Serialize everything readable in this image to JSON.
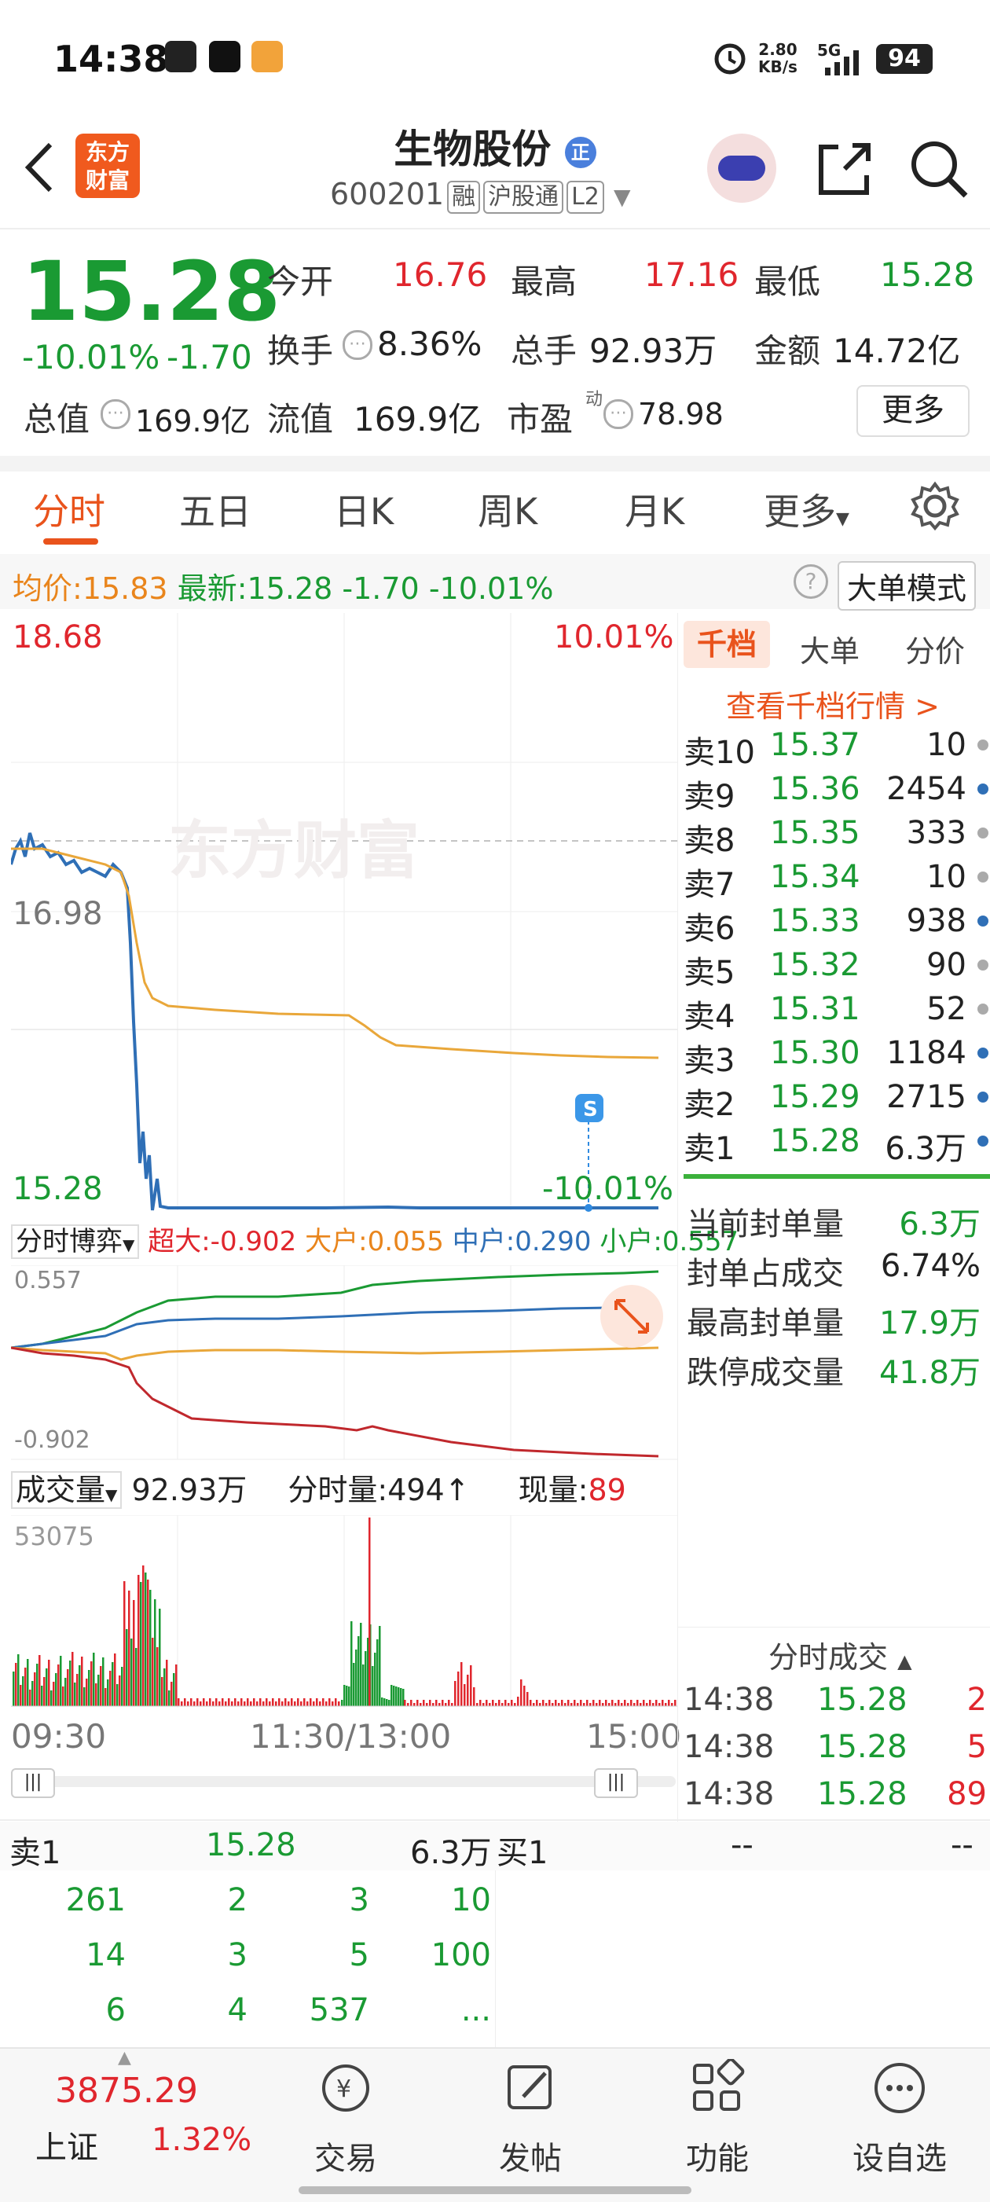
{
  "status_bar": {
    "time": "14:38",
    "net_speed": "2.80",
    "net_unit": "KB/s",
    "signal": "5G",
    "battery": "94"
  },
  "header": {
    "logo_line1": "东方",
    "logo_line2": "财富",
    "title": "生物股份",
    "title_badge": "正",
    "code": "600201",
    "tag1": "融",
    "tag2": "沪股通",
    "tag3": "L2"
  },
  "quote": {
    "price": "15.28",
    "change_pct": "-10.01%",
    "change": "-1.70",
    "open_label": "今开",
    "open": "16.76",
    "high_label": "最高",
    "high": "17.16",
    "low_label": "最低",
    "low": "15.28",
    "turnover_label": "换手",
    "turnover": "8.36%",
    "volume_label": "总手",
    "volume": "92.93万",
    "amount_label": "金额",
    "amount": "14.72亿",
    "mktcap_label": "总值",
    "mktcap": "169.9亿",
    "float_label": "流值",
    "float": "169.9亿",
    "pe_label": "市盈",
    "pe_sup": "动",
    "pe": "78.98",
    "more": "更多"
  },
  "tabs": [
    "分时",
    "五日",
    "日K",
    "周K",
    "月K",
    "更多"
  ],
  "info_line": {
    "avg_label": "均价:",
    "avg": "15.83",
    "latest_label": "最新:",
    "latest": "15.28",
    "chg": "-1.70",
    "pct": "-10.01%",
    "mode_btn": "大单模式"
  },
  "chart": {
    "top_price": "18.68",
    "top_pct": "10.01%",
    "prev_close": "16.98",
    "bottom_price": "15.28",
    "bottom_pct": "-10.01%",
    "marker": "S"
  },
  "flow": {
    "select": "分时博弈",
    "super_label": "超大:",
    "super": "-0.902",
    "big_label": "大户:",
    "big": "0.055",
    "mid_label": "中户:",
    "mid": "0.290",
    "small_label": "小户:",
    "small": "0.557",
    "top": "0.557",
    "bottom": "-0.902"
  },
  "vol": {
    "select": "成交量",
    "total": "92.93万",
    "period_label": "分时量:",
    "period": "494",
    "now_label": "现量:",
    "now": "89",
    "max": "53075"
  },
  "time_axis": [
    "09:30",
    "11:30/13:00",
    "15:00"
  ],
  "order_tabs": [
    "千档",
    "大单",
    "分价"
  ],
  "order_link": "查看千档行情 >",
  "asks": [
    {
      "label": "卖10",
      "price": "15.37",
      "vol": "10",
      "dot": "gray"
    },
    {
      "label": "卖9",
      "price": "15.36",
      "vol": "2454",
      "dot": "blue"
    },
    {
      "label": "卖8",
      "price": "15.35",
      "vol": "333",
      "dot": "gray"
    },
    {
      "label": "卖7",
      "price": "15.34",
      "vol": "10",
      "dot": "gray"
    },
    {
      "label": "卖6",
      "price": "15.33",
      "vol": "938",
      "dot": "blue"
    },
    {
      "label": "卖5",
      "price": "15.32",
      "vol": "90",
      "dot": "gray"
    },
    {
      "label": "卖4",
      "price": "15.31",
      "vol": "52",
      "dot": "gray"
    },
    {
      "label": "卖3",
      "price": "15.30",
      "vol": "1184",
      "dot": "blue"
    },
    {
      "label": "卖2",
      "price": "15.29",
      "vol": "2715",
      "dot": "blue"
    },
    {
      "label": "卖1",
      "price": "15.28",
      "vol": "6.3万",
      "dot": "blue"
    }
  ],
  "seal_stats": [
    {
      "label": "当前封单量",
      "value": "6.3万"
    },
    {
      "label": "封单占成交",
      "value": "6.74%"
    },
    {
      "label": "最高封单量",
      "value": "17.9万"
    },
    {
      "label": "跌停成交量",
      "value": "41.8万"
    }
  ],
  "ticks_title": "分时成交",
  "ticks": [
    {
      "time": "14:38",
      "price": "15.28",
      "vol": "2"
    },
    {
      "time": "14:38",
      "price": "15.28",
      "vol": "5"
    },
    {
      "time": "14:38",
      "price": "15.28",
      "vol": "89"
    }
  ],
  "bottom_book": {
    "sell_label": "卖1",
    "sell_price": "15.28",
    "sell_vol": "6.3万",
    "buy_label": "买1",
    "buy_price": "--",
    "buy_vol": "--",
    "rows": [
      [
        "261",
        "2",
        "3",
        "10"
      ],
      [
        "14",
        "3",
        "5",
        "100"
      ],
      [
        "6",
        "4",
        "537",
        "..."
      ]
    ]
  },
  "index": {
    "value": "3875.29",
    "name": "上证",
    "pct": "1.32%"
  },
  "nav": [
    "交易",
    "发帖",
    "功能",
    "设自选"
  ],
  "watermark": "东方财富"
}
